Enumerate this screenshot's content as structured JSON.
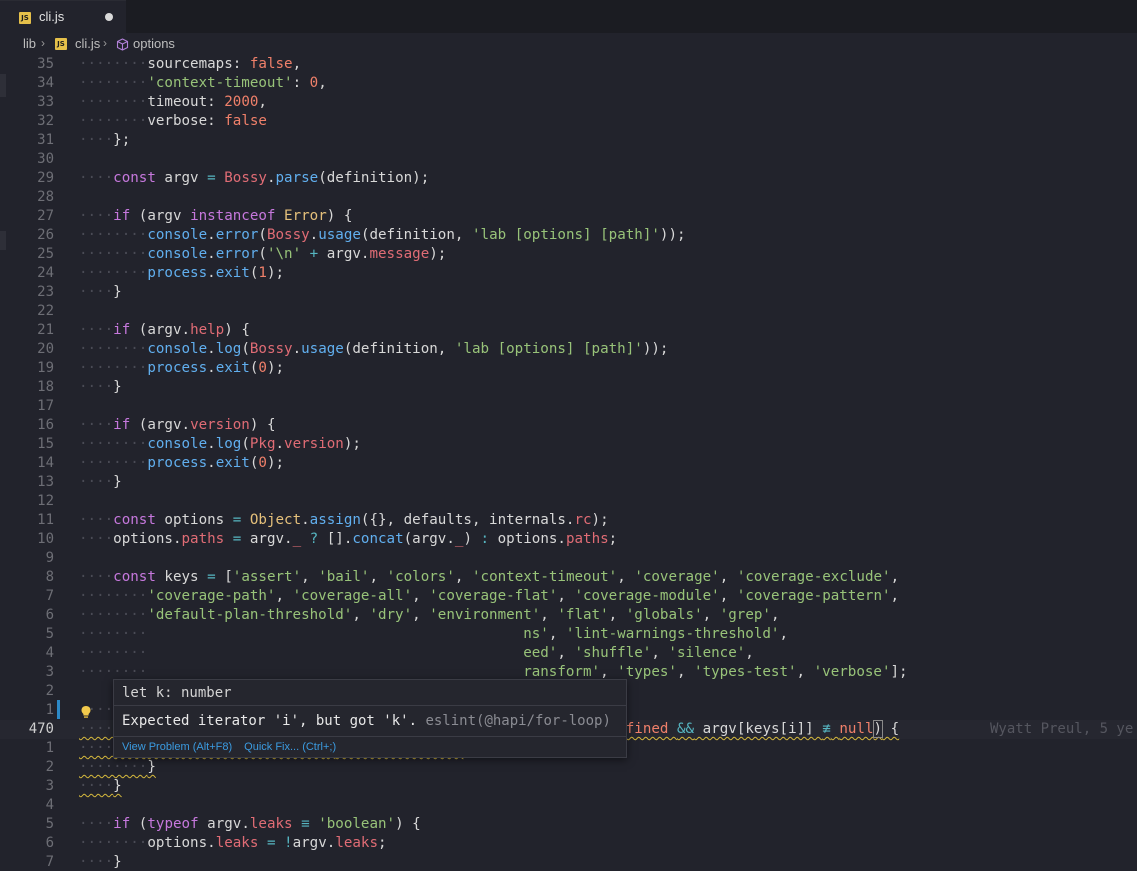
{
  "tab": {
    "icon": "JS",
    "filename": "cli.js"
  },
  "breadcrumb": {
    "folder": "lib",
    "file": "cli.js",
    "symbol": "options"
  },
  "lines": [
    {
      "n": "35"
    },
    {
      "n": "34"
    },
    {
      "n": "33"
    },
    {
      "n": "32"
    },
    {
      "n": "31"
    },
    {
      "n": "30"
    },
    {
      "n": "29"
    },
    {
      "n": "28"
    },
    {
      "n": "27"
    },
    {
      "n": "26"
    },
    {
      "n": "25"
    },
    {
      "n": "24"
    },
    {
      "n": "23"
    },
    {
      "n": "22"
    },
    {
      "n": "21"
    },
    {
      "n": "20"
    },
    {
      "n": "19"
    },
    {
      "n": "18"
    },
    {
      "n": "17"
    },
    {
      "n": "16"
    },
    {
      "n": "15"
    },
    {
      "n": "14"
    },
    {
      "n": "13"
    },
    {
      "n": "12"
    },
    {
      "n": "11"
    },
    {
      "n": "10"
    },
    {
      "n": "9"
    },
    {
      "n": "8"
    },
    {
      "n": "7"
    },
    {
      "n": "6"
    },
    {
      "n": "5"
    },
    {
      "n": "4"
    },
    {
      "n": "3"
    },
    {
      "n": "2"
    },
    {
      "n": "1"
    },
    {
      "n": "470"
    },
    {
      "n": "1"
    },
    {
      "n": "2"
    },
    {
      "n": "3"
    },
    {
      "n": "4"
    },
    {
      "n": "5"
    },
    {
      "n": "6"
    },
    {
      "n": "7"
    }
  ],
  "blame": "Wyatt Preul, 5 ye",
  "hover": {
    "signature": "let k: number",
    "message": "Expected iterator 'i', but got 'k'.",
    "source": "eslint(@hapi/for-loop)",
    "view_problem": "View Problem (Alt+F8)",
    "quick_fix": "Quick Fix... (Ctrl+;)"
  }
}
